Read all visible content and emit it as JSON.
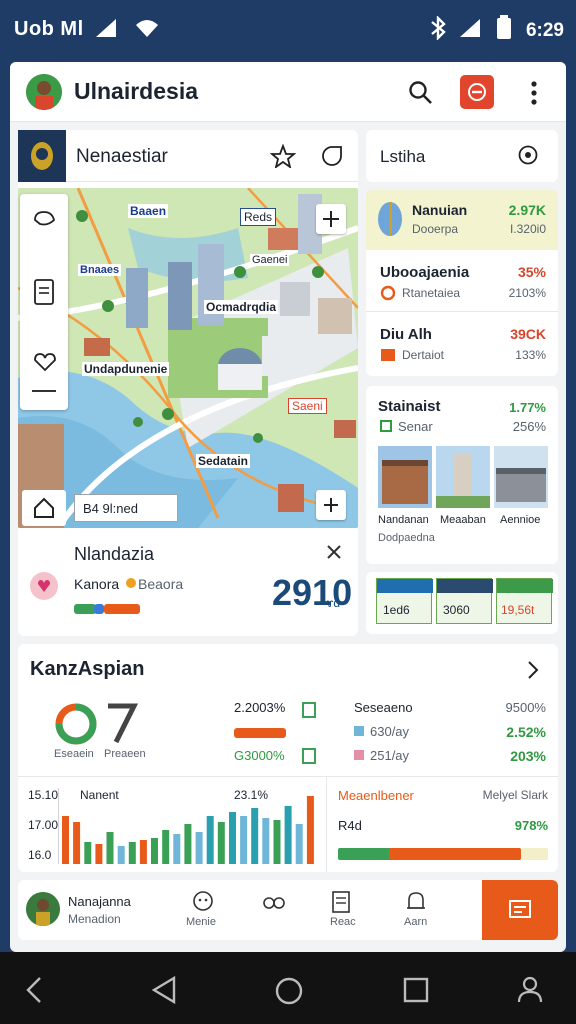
{
  "status_bar": {
    "carrier": "Uob Ml",
    "time": "6:29"
  },
  "app_bar": {
    "title": "Ulnairdesia"
  },
  "location_card": {
    "title": "Nenaestiar"
  },
  "list_header": {
    "title": "Lstiha"
  },
  "map": {
    "labels": {
      "top": "Baaen",
      "top_right": "Reds",
      "left": "Bnaaes",
      "mid": "Gaenei",
      "center": "Ocmadrqdia",
      "lower_left": "Undapdunenie",
      "lower_right": "Saeni",
      "bottom": "Sedatain"
    },
    "search_value": "B4 9l:ned"
  },
  "stock_list": [
    {
      "name": "Nanuian",
      "sub": "Dooerpa",
      "change": "2.97K",
      "value": "I.320i0",
      "trend": "up"
    },
    {
      "name": "Ubooajaenia",
      "sub": "Rtanetaiea",
      "change": "35%",
      "value": "2103%",
      "trend": "down"
    },
    {
      "name": "Diu Alh",
      "sub": "Dertaiot",
      "change": "39CK",
      "value": "133%",
      "trend": "down"
    }
  ],
  "gallery_card": {
    "title": "Stainaist",
    "title_value": "1.77%",
    "sub": "Senar",
    "sub_value": "256%",
    "captions": [
      "Nandanan",
      "Meaaban",
      "Aennioe"
    ],
    "caption_sub": "Dodpaedna"
  },
  "price_tiles": [
    "1ed6",
    "3060",
    "19,56t"
  ],
  "detail_card": {
    "title": "Nlandazia",
    "label": "Kanora",
    "tag": "Beaora",
    "value": "2910",
    "value_small": "Ƨ0",
    "value_unit": "ɤd"
  },
  "summary_card": {
    "title": "KanzAspian",
    "ring_label": "Eseaein",
    "icon_label": "Preaeen",
    "rows": [
      {
        "value": "2.2003%",
        "name": "Seseaeno",
        "pct": "9500%"
      },
      {
        "value": "G3000%",
        "name": "630/ay",
        "pct": "2.52%"
      },
      {
        "value": "",
        "name": "251/ay",
        "pct": "203%"
      }
    ]
  },
  "chart_data": {
    "type": "bar",
    "title": "Nanent",
    "annotation": "23.1%",
    "y_tick_labels": [
      "15.10",
      "17.00",
      "16.0"
    ],
    "values": [
      48,
      42,
      22,
      20,
      32,
      18,
      22,
      24,
      26,
      34,
      30,
      40,
      32,
      48,
      42,
      52,
      48,
      56,
      46,
      44,
      58,
      40,
      68
    ]
  },
  "progress_card": {
    "title": "Meaenlbener",
    "title_right": "Melyel Slark",
    "label": "R4d",
    "value": "978%",
    "progress": 0.87
  },
  "bottom_nav": {
    "user_name": "Nanajanna",
    "user_sub": "Menadion",
    "tabs": [
      "Menie",
      "",
      "Reac",
      "Aarn"
    ]
  },
  "colors": {
    "brand": "#e85a1a",
    "accent_red": "#e2452e",
    "status_bg": "#1f3c66"
  },
  "icons": [
    "search-icon",
    "stop-icon",
    "more-icon",
    "star-icon",
    "tag-icon",
    "target-icon",
    "plus-icon",
    "home-icon",
    "close-icon",
    "chevron-right-icon"
  ]
}
